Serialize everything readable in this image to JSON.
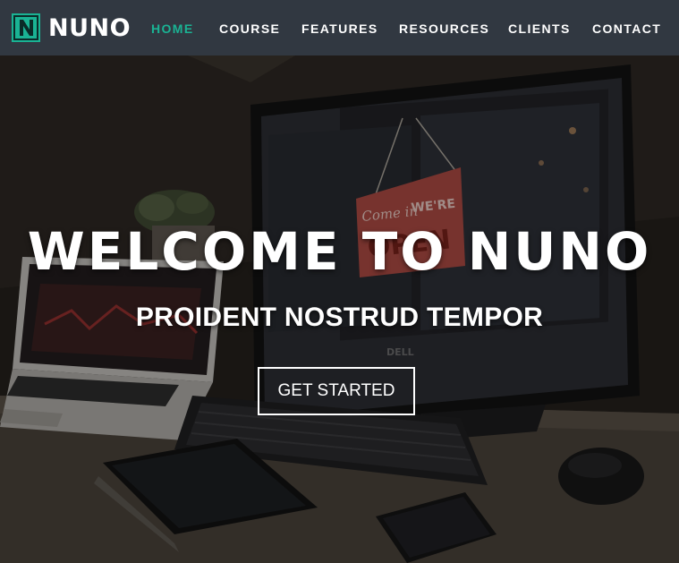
{
  "brand": {
    "name": "NUNO",
    "logo_letter": "N",
    "logo_icon": "n-logo-icon",
    "accent": "#1ab394"
  },
  "nav": {
    "items": [
      {
        "label": "HOME",
        "active": true
      },
      {
        "label": "COURSE",
        "active": false
      },
      {
        "label": "FEATURES",
        "active": false
      },
      {
        "label": "RESOURCES",
        "active": false
      },
      {
        "label": "CLIENTS",
        "active": false
      },
      {
        "label": "CONTACT",
        "active": false
      }
    ],
    "background": "#313841",
    "active_color": "#1ab394"
  },
  "hero": {
    "title": "WELCOME TO NUNO",
    "subtitle": "PROIDENT NOSTRUD TEMPOR",
    "cta_label": "GET STARTED",
    "sign_text_1": "Come in",
    "sign_text_2": "WE'RE",
    "sign_text_3": "OPEN",
    "monitor_brand": "DELL"
  }
}
